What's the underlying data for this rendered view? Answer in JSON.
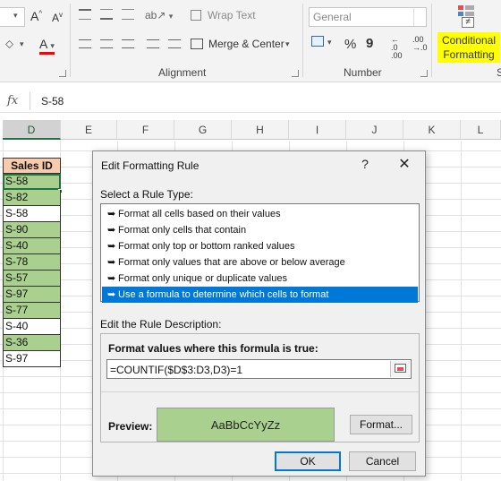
{
  "ribbon": {
    "font_size_up_label": "A",
    "font_size_down_label": "A",
    "font_color_label": "A",
    "wrap_text_label": "Wrap Text",
    "merge_center_label": "Merge & Center",
    "alignment_group_label": "Alignment",
    "number_format_value": "General",
    "percent_label": "%",
    "comma_label": "9",
    "increase_decimal_label": ".0\n.00",
    "decrease_decimal_label": ".00\n.0",
    "number_group_label": "Number",
    "conditional_formatting_line1": "Conditional",
    "conditional_formatting_line2": "Formatting",
    "accent_color": "#ffff00"
  },
  "formula_bar": {
    "fx_label": "fx",
    "value": "S-58"
  },
  "columns": [
    "D",
    "E",
    "F",
    "G",
    "H",
    "I",
    "J",
    "K",
    "L"
  ],
  "sheet": {
    "header": "Sales ID",
    "cells": [
      {
        "value": "S-58",
        "highlight": true
      },
      {
        "value": "S-82",
        "highlight": true
      },
      {
        "value": "S-58",
        "highlight": false
      },
      {
        "value": "S-90",
        "highlight": true
      },
      {
        "value": "S-40",
        "highlight": true
      },
      {
        "value": "S-78",
        "highlight": true
      },
      {
        "value": "S-57",
        "highlight": true
      },
      {
        "value": "S-97",
        "highlight": true
      },
      {
        "value": "S-77",
        "highlight": true
      },
      {
        "value": "S-40",
        "highlight": false
      },
      {
        "value": "S-36",
        "highlight": true
      },
      {
        "value": "S-97",
        "highlight": false
      }
    ],
    "highlight_color": "#a9d08e",
    "header_color": "#f8cbad"
  },
  "dialog": {
    "title": "Edit Formatting Rule",
    "help_label": "?",
    "close_label": "✕",
    "select_rule_type_label": "Select a Rule Type:",
    "rule_types": [
      {
        "label": "Format all cells based on their values",
        "selected": false
      },
      {
        "label": "Format only cells that contain",
        "selected": false
      },
      {
        "label": "Format only top or bottom ranked values",
        "selected": false
      },
      {
        "label": "Format only values that are above or below average",
        "selected": false
      },
      {
        "label": "Format only unique or duplicate values",
        "selected": false
      },
      {
        "label": "Use a formula to determine which cells to format",
        "selected": true
      }
    ],
    "edit_description_label": "Edit the Rule Description:",
    "formula_label": "Format values where this formula is true:",
    "formula_value": "=COUNTIF($D$3:D3,D3)=1",
    "preview_label": "Preview:",
    "preview_text": "AaBbCcYyZz",
    "format_button_label": "Format...",
    "ok_label": "OK",
    "cancel_label": "Cancel",
    "selection_color": "#0078d7"
  }
}
